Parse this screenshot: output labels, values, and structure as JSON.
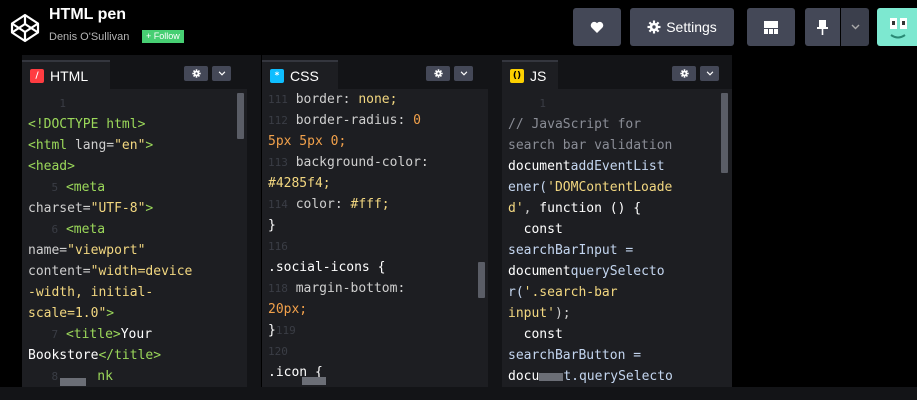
{
  "header": {
    "pen_title": "HTML pen",
    "author": "Denis O'Sullivan",
    "follow_label": "+ Follow",
    "settings_label": "Settings"
  },
  "colors": {
    "background": "#000000",
    "editor_bg": "#1d1e22",
    "button_bg": "#444857",
    "follow_green": "#47cf73",
    "html_icon": "#ff3c41",
    "css_icon": "#0ebeff",
    "js_icon": "#fcd000"
  },
  "icons": {
    "logo": "codepen-logo-icon",
    "heart": "heart-icon",
    "settings": "gear-icon",
    "layout": "layout-icon",
    "pin": "pin-icon",
    "caret": "chevron-down-icon"
  },
  "editors": {
    "html": {
      "tab_label": "HTML",
      "lines": [
        {
          "n": "1"
        },
        {
          "t": "<!DOCTYPE html>"
        },
        {
          "t1": "<html ",
          "t2": "lang=",
          "t3": "\"en\"",
          "t4": ">"
        },
        {
          "t": "<head>"
        },
        {
          "n": "5",
          "t": "<meta"
        },
        {
          "t1": "charset=",
          "t2": "\"UTF-8\"",
          "t3": ">"
        },
        {
          "n": "6",
          "t": "<meta"
        },
        {
          "t1": "name=",
          "t2": "\"viewport\""
        },
        {
          "t1": "content=",
          "t2": "\"width=device"
        },
        {
          "t": "-width, initial-"
        },
        {
          "t1": "scale=1.0\"",
          "t2": ">"
        },
        {
          "n": "7",
          "t1": "<title>",
          "t2": "Your"
        },
        {
          "t1": "Bookstore",
          "t2": "</title>"
        },
        {
          "n": "8",
          "t": "nk"
        }
      ]
    },
    "css": {
      "tab_label": "CSS",
      "lines": [
        {
          "n": "111",
          "t1": "border: ",
          "t2": "none;"
        },
        {
          "n": "112",
          "t1": "border-radius: ",
          "t2": "0"
        },
        {
          "t1": "5px 5px 0;"
        },
        {
          "n": "113",
          "t1": "background-color:"
        },
        {
          "t1": "#4285f4;"
        },
        {
          "n": "114",
          "t1": "color: ",
          "t2": "#fff;"
        },
        {
          "t1": "}"
        },
        {
          "n": "116"
        },
        {
          "t1": ".social-icons {"
        },
        {
          "n": "118",
          "t1": "margin-bottom:"
        },
        {
          "t1": "20px;"
        },
        {
          "t1": "}",
          "n": "119"
        },
        {
          "n": "120"
        },
        {
          "t1": ".icon {"
        }
      ]
    },
    "js": {
      "tab_label": "JS",
      "lines": [
        {
          "n": "1"
        },
        {
          "t": "// JavaScript for"
        },
        {
          "t": "search bar validation"
        },
        {
          "t1": "document",
          ".": ".",
          "t2": "addEventList"
        },
        {
          "t1": "ener(",
          "t2": "'DOMContentLoade"
        },
        {
          "t1": "d'",
          ",": ",",
          "t2": " function () {"
        },
        {
          "t": "const"
        },
        {
          "t": "searchBarInput ="
        },
        {
          "t1": "document",
          ".": ".",
          "t2": "querySelecto"
        },
        {
          "t1": "r(",
          "t2": "'.search-bar"
        },
        {
          "t1": "input'",
          "t2": ");"
        },
        {
          "t": "const"
        },
        {
          "t": "searchBarButton ="
        },
        {
          "t1": "docu",
          "t2": "t.querySelecto"
        }
      ]
    }
  }
}
